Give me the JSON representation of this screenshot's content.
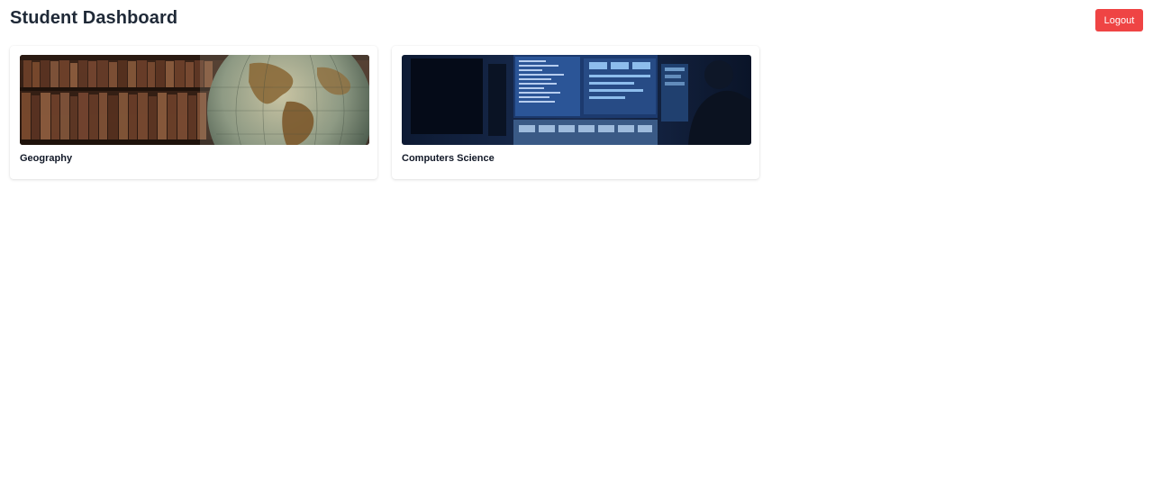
{
  "header": {
    "title": "Student Dashboard",
    "logout_label": "Logout"
  },
  "courses": [
    {
      "name": "Geography",
      "image": "globe-and-books-photo"
    },
    {
      "name": "Computers Science",
      "image": "computer-monitors-photo"
    }
  ],
  "colors": {
    "logout_button": "#ef4444",
    "title_text": "#1f2937"
  }
}
